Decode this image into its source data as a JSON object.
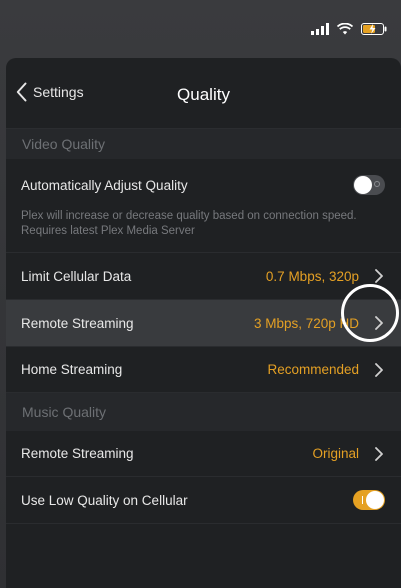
{
  "status_bar": {
    "icons": [
      "signal-icon",
      "wifi-icon",
      "battery-charging-icon"
    ],
    "accent": "#e5a122"
  },
  "nav": {
    "back_label": "Settings",
    "title": "Quality"
  },
  "sections": {
    "video": {
      "header": "Video Quality",
      "auto_adjust": {
        "label": "Automatically Adjust Quality",
        "description": "Plex will increase or decrease quality based on connection speed. Requires latest Plex Media Server",
        "enabled": false
      },
      "limit_cellular": {
        "label": "Limit Cellular Data",
        "value": "0.7 Mbps, 320p"
      },
      "remote_streaming": {
        "label": "Remote Streaming",
        "value": "3 Mbps, 720p HD"
      },
      "home_streaming": {
        "label": "Home Streaming",
        "value": "Recommended"
      }
    },
    "music": {
      "header": "Music Quality",
      "remote_streaming": {
        "label": "Remote Streaming",
        "value": "Original"
      },
      "low_quality_cellular": {
        "label": "Use Low Quality on Cellular",
        "enabled": true
      }
    }
  },
  "colors": {
    "accent": "#e5a122",
    "background": "#1f2123",
    "highlight_row": "#393b3e"
  }
}
